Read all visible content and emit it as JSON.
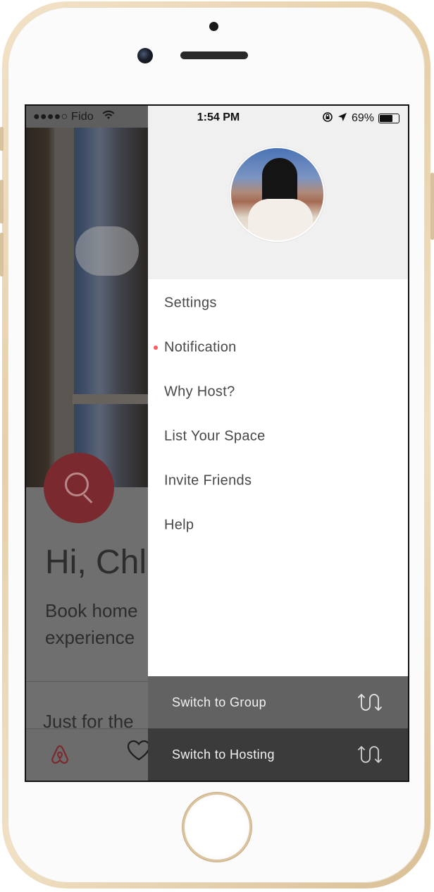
{
  "status_bar": {
    "carrier": "●●●●○ Fido",
    "time": "1:54 PM",
    "battery": "69%"
  },
  "background_app": {
    "greeting": "Hi, Chl",
    "subtitle_line1": "Book home",
    "subtitle_line2": "experience",
    "section_heading": "Just for the"
  },
  "drawer": {
    "menu": [
      {
        "label": "Settings",
        "has_dot": false
      },
      {
        "label": "Notification",
        "has_dot": true
      },
      {
        "label": "Why Host?",
        "has_dot": false
      },
      {
        "label": "List Your Space",
        "has_dot": false
      },
      {
        "label": "Invite Friends",
        "has_dot": false
      },
      {
        "label": "Help",
        "has_dot": false
      }
    ],
    "switch_group": "Switch to Group",
    "switch_hosting": "Switch to Hosting"
  },
  "colors": {
    "accent": "#ff5a5f",
    "drawer_header": "#f0f0f0",
    "switch_group_bg": "#626262",
    "switch_hosting_bg": "#3b3b3b"
  },
  "icons": {
    "search": "search-icon",
    "switch": "switch-arrows-icon",
    "logo": "airbnb-logo-icon",
    "heart": "heart-icon"
  }
}
